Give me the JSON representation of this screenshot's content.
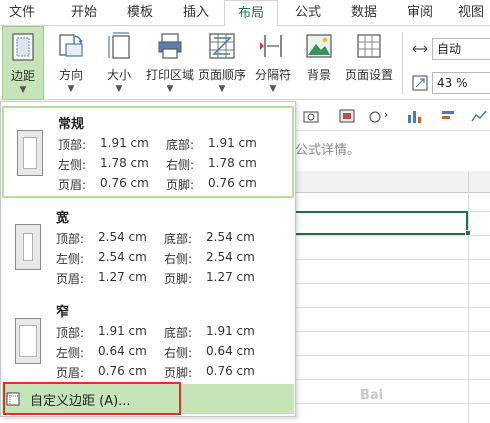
{
  "tabs": [
    {
      "label": "文件"
    },
    {
      "label": "开始"
    },
    {
      "label": "模板"
    },
    {
      "label": "插入"
    },
    {
      "label": "布局",
      "active": true
    },
    {
      "label": "公式"
    },
    {
      "label": "数据"
    },
    {
      "label": "审阅"
    },
    {
      "label": "视图"
    }
  ],
  "ribbon": {
    "margins": "边距",
    "orientation": "方向",
    "size": "大小",
    "print_area": "打印区域",
    "page_order": "页面顺序",
    "breaks": "分隔符",
    "background": "背景",
    "page_setup": "页面设置",
    "scale_mode": "自动",
    "zoom": "43 %",
    "accent": "#217346",
    "pressed_color": "#c5e5b9"
  },
  "sheet": {
    "formula_hint": "公式详情。"
  },
  "margin_presets": [
    {
      "name": "常规",
      "top_label": "顶部:",
      "top": "1.91 cm",
      "bottom_label": "底部:",
      "bottom": "1.91 cm",
      "left_label": "左侧:",
      "left": "1.78 cm",
      "right_label": "右侧:",
      "right": "1.78 cm",
      "header_label": "页眉:",
      "header": "0.76 cm",
      "footer_label": "页脚:",
      "footer": "0.76 cm"
    },
    {
      "name": "宽",
      "top_label": "顶部:",
      "top": "2.54 cm",
      "bottom_label": "底部:",
      "bottom": "2.54 cm",
      "left_label": "左侧:",
      "left": "2.54 cm",
      "right_label": "右侧:",
      "right": "2.54 cm",
      "header_label": "页眉:",
      "header": "1.27 cm",
      "footer_label": "页脚:",
      "footer": "1.27 cm"
    },
    {
      "name": "窄",
      "top_label": "顶部:",
      "top": "1.91 cm",
      "bottom_label": "底部:",
      "bottom": "1.91 cm",
      "left_label": "左侧:",
      "left": "0.64 cm",
      "right_label": "右侧:",
      "right": "0.64 cm",
      "header_label": "页眉:",
      "header": "0.76 cm",
      "footer_label": "页脚:",
      "footer": "0.76 cm"
    }
  ],
  "custom_margins": "自定义边距 (A)...",
  "watermark": "Bai"
}
